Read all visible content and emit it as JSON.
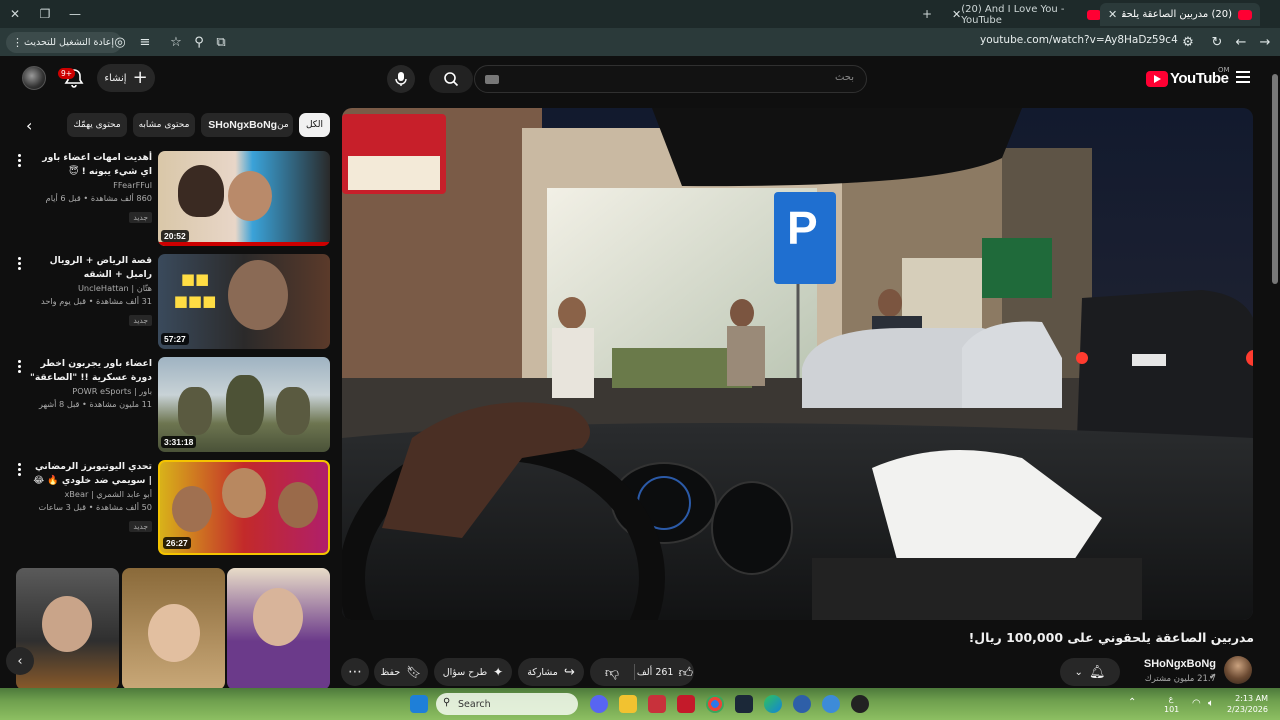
{
  "browser": {
    "tabs": [
      {
        "title": "(20) مدربين الصاعقة يلحقوني ع...",
        "active": true
      },
      {
        "title": "(20) And I Love You - YouTube",
        "active": false
      }
    ],
    "new_tab": "+",
    "url": "youtube.com/watch?v=Ay8HaDz59c4",
    "reload_update_label": "إعادة التشغيل للتحديث"
  },
  "youtube": {
    "logo_text": "YouTube",
    "country_code": "OM",
    "search_placeholder": "بحث",
    "create_label": "إنشاء",
    "notification_count": "9+"
  },
  "chips": [
    {
      "label": "الكل",
      "active": true
    },
    {
      "label": "من",
      "channel": "SHoNgxBoNg",
      "active": false
    },
    {
      "label": "محتوى مشابه",
      "active": false
    },
    {
      "label": "محتوى يهمّك",
      "active": false
    }
  ],
  "video": {
    "title": "مدربين الصاعقة يلحقوني على 100,000 ريال!",
    "channel": "SHoNgxBoNg",
    "subscribers": "21.7 مليون مشترك",
    "likes": "261 ألف",
    "share_label": "مشاركة",
    "ask_label": "طرح سؤال",
    "save_label": "حفظ"
  },
  "recommendations": [
    {
      "title": "أهديت امهات اعضاء باور اي شيء يبونه ! 😇",
      "channel": "FFearFFul",
      "stats": "860 ألف مشاهدة • قبل 6 أيام",
      "badge": "جديد",
      "duration": "20:52"
    },
    {
      "title": "قصة الرياض + الرويال رامبل + الشقه",
      "channel": "هتّان | UncleHattan",
      "stats": "31 ألف مشاهدة • قبل يوم واحد",
      "badge": "جديد",
      "duration": "57:27"
    },
    {
      "title": "اعضاء باور يجربون اخطر دورة عسكرية !! \"الصاعقة\" ⚡",
      "channel": "باور | POWR eSports",
      "stats": "11 مليون مشاهدة • قبل 8 أشهر",
      "badge": "",
      "duration": "3:31:18"
    },
    {
      "title": "تحدي اليوتيوبرز الرمضاني | سويمي ضد خلودي 🔥 😂",
      "channel": "أبو عابد الشمري | xBear",
      "stats": "50 ألف مشاهدة • قبل 3 ساعات",
      "badge": "جديد",
      "duration": "26:27"
    }
  ],
  "taskbar": {
    "search_label": "Search",
    "time": "2:13 AM",
    "date": "2/23/2026",
    "lang": "ع",
    "lang_num": "101"
  }
}
